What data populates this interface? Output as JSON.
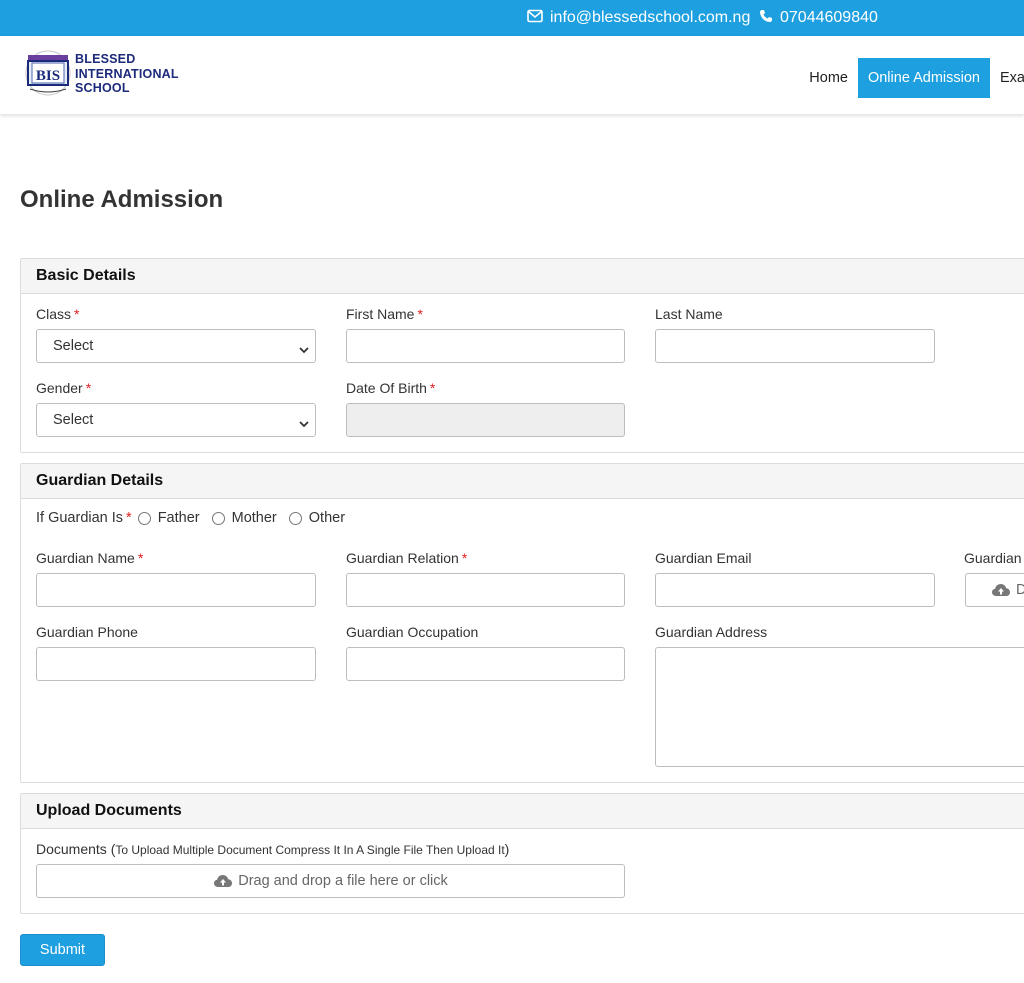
{
  "topbar": {
    "email": "info@blessedschool.com.ng",
    "phone": "07044609840"
  },
  "brand": {
    "line1": "BLESSED",
    "line2": "INTERNATIONAL",
    "line3": "SCHOOL",
    "badge_text": "BIS"
  },
  "nav": {
    "items": [
      "Home",
      "Online Admission",
      "Exa"
    ],
    "active": "Online Admission"
  },
  "page": {
    "title": "Online Admission"
  },
  "basic": {
    "heading": "Basic Details",
    "class_label": "Class",
    "class_value": "Select",
    "first_name_label": "First Name",
    "last_name_label": "Last Name",
    "gender_label": "Gender",
    "gender_value": "Select",
    "dob_label": "Date Of Birth",
    "required_mark": "*"
  },
  "guardian": {
    "heading": "Guardian Details",
    "if_label": "If Guardian Is",
    "options": [
      "Father",
      "Mother",
      "Other"
    ],
    "name_label": "Guardian Name",
    "relation_label": "Guardian Relation",
    "email_label": "Guardian Email",
    "photo_label": "Guardian",
    "photo_btn": "D",
    "phone_label": "Guardian Phone",
    "occupation_label": "Guardian Occupation",
    "address_label": "Guardian Address",
    "required_mark": "*"
  },
  "upload": {
    "heading": "Upload Documents",
    "doc_label": "Documents (",
    "doc_note": "To Upload Multiple Document Compress It In A Single File Then Upload It",
    "doc_label_close": ")",
    "dropzone_text": "Drag and drop a file here or click"
  },
  "form": {
    "submit_label": "Submit"
  },
  "colors": {
    "accent": "#1e9fdf",
    "brand": "#1c2a7a",
    "required": "#e02020"
  }
}
